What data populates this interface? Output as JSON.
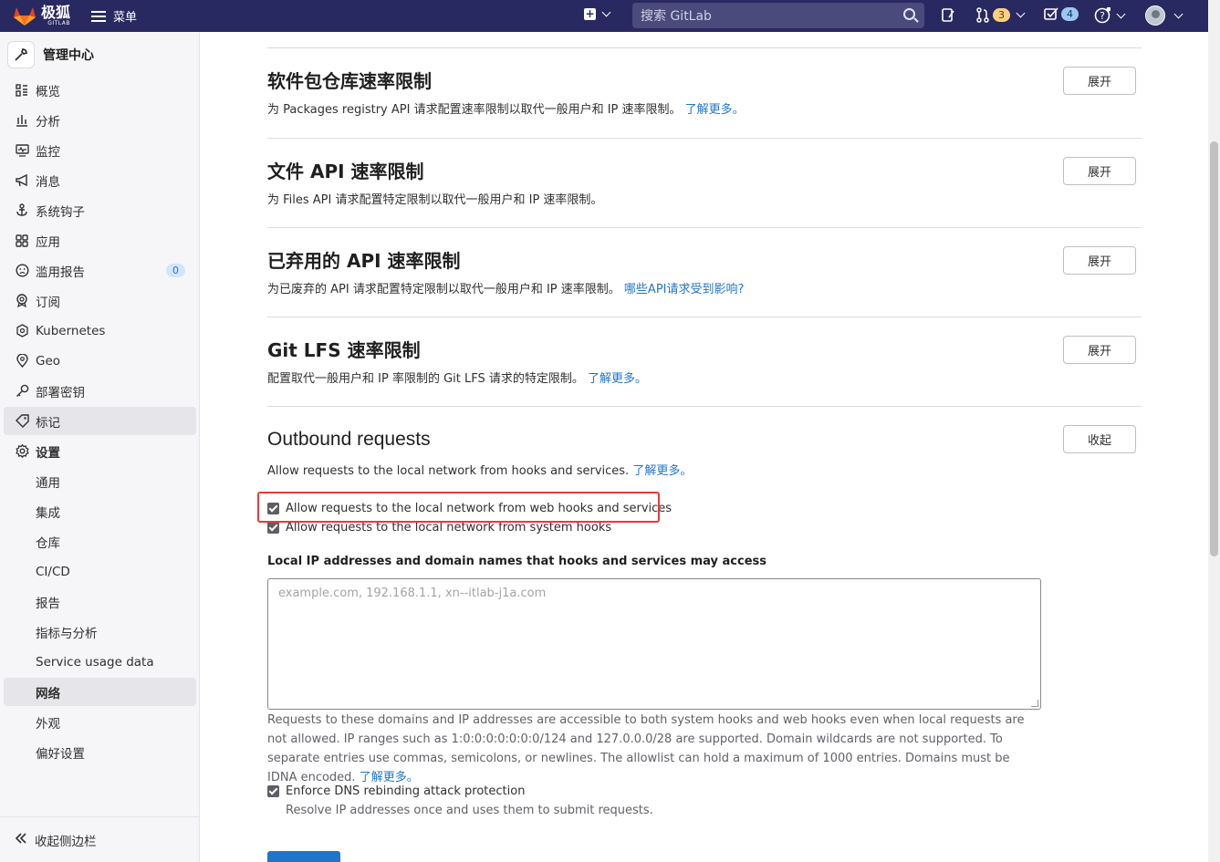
{
  "topbar": {
    "brand_name": "极狐",
    "brand_sub": "GITLAB",
    "menu_label": "菜单",
    "search_placeholder": "搜索 GitLab",
    "merge_requests_count": "3",
    "todos_count": "4"
  },
  "sidebar": {
    "header": "管理中心",
    "items": [
      {
        "label": "概览",
        "icon": "overview-icon"
      },
      {
        "label": "分析",
        "icon": "analytics-icon"
      },
      {
        "label": "监控",
        "icon": "monitor-icon"
      },
      {
        "label": "消息",
        "icon": "messages-icon"
      },
      {
        "label": "系统钩子",
        "icon": "hook-icon"
      },
      {
        "label": "应用",
        "icon": "applications-icon"
      },
      {
        "label": "滥用报告",
        "icon": "abuse-icon",
        "badge": "0"
      },
      {
        "label": "订阅",
        "icon": "subscription-icon"
      },
      {
        "label": "Kubernetes",
        "icon": "kubernetes-icon"
      },
      {
        "label": "Geo",
        "icon": "geo-icon"
      },
      {
        "label": "部署密钥",
        "icon": "key-icon"
      },
      {
        "label": "标记",
        "icon": "label-icon"
      },
      {
        "label": "设置",
        "icon": "settings-icon"
      }
    ],
    "settings_sub": [
      "通用",
      "集成",
      "仓库",
      "CI/CD",
      "报告",
      "指标与分析",
      "Service usage data",
      "网络",
      "外观",
      "偏好设置"
    ],
    "collapse_label": "收起侧边栏"
  },
  "sections": [
    {
      "title": "软件包仓库速率限制",
      "desc": "为 Packages registry API 请求配置速率限制以取代一般用户和 IP 速率限制。",
      "link": "了解更多。",
      "button": "展开"
    },
    {
      "title": "文件 API 速率限制",
      "desc": "为 Files API 请求配置特定限制以取代一般用户和 IP 速率限制。",
      "link": "",
      "button": "展开"
    },
    {
      "title": "已弃用的 API 速率限制",
      "desc": "为已废弃的 API 请求配置特定限制以取代一般用户和 IP 速率限制。",
      "link": "哪些API请求受到影响?",
      "button": "展开"
    },
    {
      "title": "Git LFS 速率限制",
      "desc": "配置取代一般用户和 IP 率限制的 Git LFS 请求的特定限制。",
      "link": "了解更多。",
      "button": "展开"
    }
  ],
  "outbound": {
    "title": "Outbound requests",
    "desc": "Allow requests to the local network from hooks and services.",
    "link": "了解更多。",
    "button": "收起",
    "check_web_hooks": "Allow requests to the local network from web hooks and services",
    "check_system_hooks": "Allow requests to the local network from system hooks",
    "allowlist_label": "Local IP addresses and domain names that hooks and services may access",
    "allowlist_placeholder": "example.com, 192.168.1.1, xn--itlab-j1a.com",
    "allowlist_help": "Requests to these domains and IP addresses are accessible to both system hooks and web hooks even when local requests are not allowed. IP ranges such as 1:0:0:0:0:0:0:0/124 and 127.0.0.0/28 are supported. Domain wildcards are not supported. To separate entries use commas, semicolons, or newlines. The allowlist can hold a maximum of 1000 entries. Domains must be IDNA encoded.",
    "allowlist_help_link": "了解更多。",
    "dns_label": "Enforce DNS rebinding attack protection",
    "dns_help": "Resolve IP addresses once and uses them to submit requests."
  }
}
